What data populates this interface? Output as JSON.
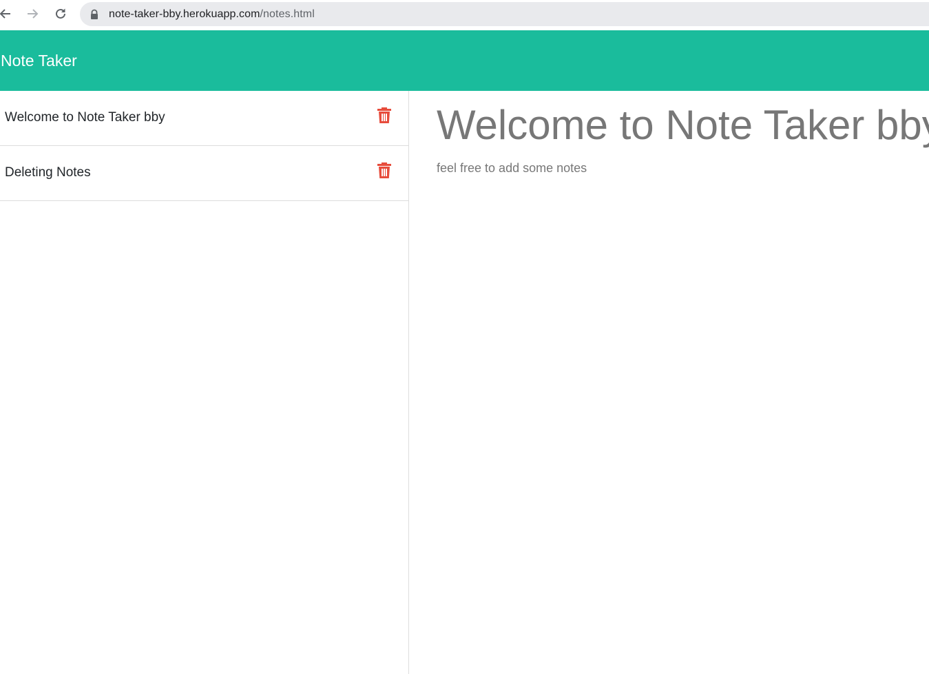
{
  "browser": {
    "url_host": "note-taker-bby.herokuapp.com",
    "url_path": "/notes.html",
    "icons": [
      "back-icon",
      "forward-icon",
      "reload-icon",
      "lock-icon"
    ]
  },
  "navbar": {
    "brand": "Note Taker",
    "background_color": "#1abc9c"
  },
  "sidebar": {
    "items": [
      {
        "label": "Welcome to Note Taker bby",
        "icon": "trash-icon"
      },
      {
        "label": "Deleting Notes",
        "icon": "trash-icon"
      }
    ],
    "delete_icon_color": "#e74c3c"
  },
  "main": {
    "note_title": "Welcome to Note Taker bby",
    "note_text": "feel free to add some notes"
  }
}
